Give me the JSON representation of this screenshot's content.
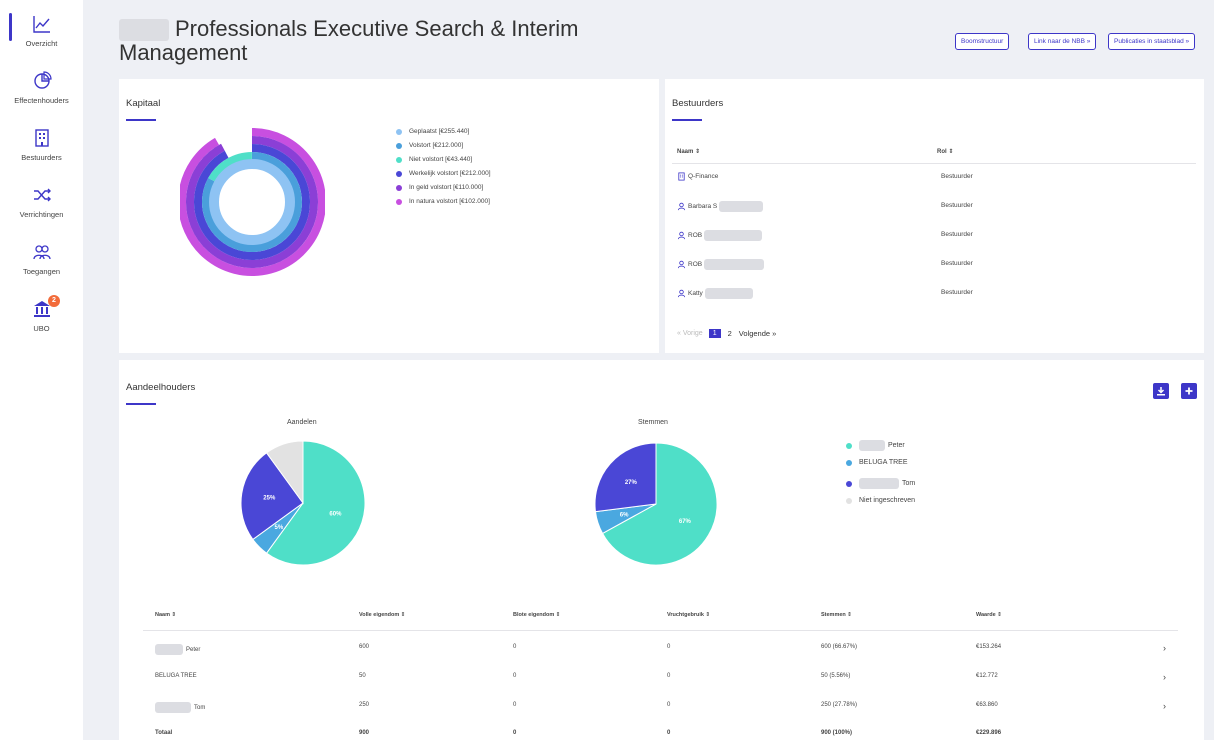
{
  "sidebar": {
    "items": [
      {
        "label": "Overzicht",
        "icon": "line-chart-icon"
      },
      {
        "label": "Effectenhouders",
        "icon": "pie-chart-icon"
      },
      {
        "label": "Bestuurders",
        "icon": "building-icon"
      },
      {
        "label": "Verrichtingen",
        "icon": "shuffle-icon"
      },
      {
        "label": "Toegangen",
        "icon": "users-icon"
      },
      {
        "label": "UBO",
        "icon": "bank-icon",
        "badge": "2"
      }
    ]
  },
  "header": {
    "title": "Professionals Executive Search & Interim Management",
    "buttons": [
      "Boomstructuur",
      "Link naar de NBB »",
      "Publicaties in staatsblad »"
    ]
  },
  "kapitaal": {
    "title": "Kapitaal",
    "legend": [
      {
        "label": "Geplaatst [€255.440]",
        "color": "#8ec3f3"
      },
      {
        "label": "Volstort [€212.000]",
        "color": "#4a9fdb"
      },
      {
        "label": "Niet volstort [€43.440]",
        "color": "#4fdfc8"
      },
      {
        "label": "Werkelijk volstort [€212.000]",
        "color": "#4a47d6"
      },
      {
        "label": "In geld volstort [€110.000]",
        "color": "#8b3fd6"
      },
      {
        "label": "In natura volstort [€102.000]",
        "color": "#c84fe0"
      }
    ]
  },
  "chart_data": [
    {
      "type": "pie",
      "title": "Aandelen",
      "categories": [
        "Peter",
        "BELUGA TREE",
        "Tom",
        "Niet ingeschreven"
      ],
      "values": [
        60,
        5,
        25,
        10
      ],
      "labels": [
        "60%",
        "5%",
        "25%",
        ""
      ]
    },
    {
      "type": "pie",
      "title": "Stemmen",
      "categories": [
        "Peter",
        "BELUGA TREE",
        "Tom"
      ],
      "values": [
        67,
        6,
        27
      ],
      "labels": [
        "67%",
        "6%",
        "27%"
      ]
    }
  ],
  "bestuurders": {
    "title": "Bestuurders",
    "headers": [
      "Naam",
      "Rol"
    ],
    "rows": [
      {
        "naam": "Q-Finance",
        "rol": "Bestuurder",
        "icon": "building-icon"
      },
      {
        "naam": "Barbara S",
        "rol": "Bestuurder",
        "icon": "person-icon"
      },
      {
        "naam": "ROB",
        "rol": "Bestuurder",
        "icon": "person-icon"
      },
      {
        "naam": "ROB",
        "rol": "Bestuurder",
        "icon": "person-icon"
      },
      {
        "naam": "Katty",
        "rol": "Bestuurder",
        "icon": "person-icon"
      }
    ],
    "pager": {
      "prev": "« Vorige",
      "pages": [
        "1",
        "2"
      ],
      "next": "Volgende »"
    }
  },
  "aandeelhouders": {
    "title": "Aandeelhouders",
    "pie1_title": "Aandelen",
    "pie2_title": "Stemmen",
    "legend": [
      {
        "label": "Peter",
        "color": "#4fdfc8"
      },
      {
        "label": "BELUGA TREE",
        "color": "#4aa8e0"
      },
      {
        "label": "Tom",
        "color": "#4a47d6"
      },
      {
        "label": "Niet ingeschreven",
        "color": "#e2e2e2"
      }
    ],
    "headers": [
      "Naam",
      "Volle eigendom",
      "Blote eigendom",
      "Vruchtgebruik",
      "Stemmen",
      "Waarde"
    ],
    "rows": [
      [
        "Peter",
        "600",
        "0",
        "0",
        "600 (66.67%)",
        "€153.264"
      ],
      [
        "BELUGA TREE",
        "50",
        "0",
        "0",
        "50 (5.56%)",
        "€12.772"
      ],
      [
        "Tom",
        "250",
        "0",
        "0",
        "250 (27.78%)",
        "€63.860"
      ]
    ],
    "total": [
      "Totaal",
      "900",
      "0",
      "0",
      "900 (100%)",
      "€229.896"
    ]
  }
}
